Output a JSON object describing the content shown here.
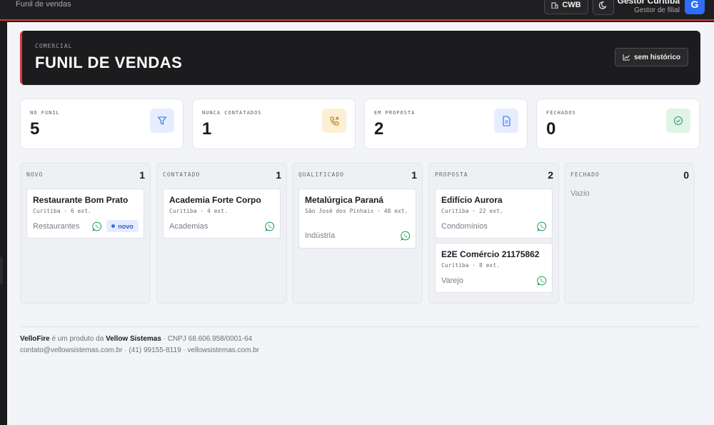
{
  "topbar": {
    "crumb": "Funil de vendas",
    "branch": "CWB",
    "user_name": "Gestor Curitiba",
    "user_role": "Gestor de filial",
    "avatar_letter": "G"
  },
  "hero": {
    "eyebrow": "COMERCIAL",
    "title": "FUNIL DE VENDAS",
    "history_button": "sem histórico"
  },
  "stats": [
    {
      "label": "NO FUNIL",
      "value": "5",
      "icon": "filter-icon",
      "color": "#2f6df6"
    },
    {
      "label": "NUNCA CONTATADOS",
      "value": "1",
      "icon": "phone-icon",
      "color": "#b7791f"
    },
    {
      "label": "EM PROPOSTA",
      "value": "2",
      "icon": "document-icon",
      "color": "#2f6df6"
    },
    {
      "label": "FECHADOS",
      "value": "0",
      "icon": "check-circle-icon",
      "color": "#2f9e57"
    }
  ],
  "columns": [
    {
      "title": "NOVO",
      "count": "1",
      "cards": [
        {
          "name": "Restaurante Bom Prato",
          "meta": "Curitiba · 6 ext.",
          "segment": "Restaurantes",
          "badge": "novo"
        }
      ]
    },
    {
      "title": "CONTATADO",
      "count": "1",
      "cards": [
        {
          "name": "Academia Forte Corpo",
          "meta": "Curitiba · 4 ext.",
          "segment": "Academias"
        }
      ]
    },
    {
      "title": "QUALIFICADO",
      "count": "1",
      "cards": [
        {
          "name": "Metalúrgica Paraná",
          "meta": "São José dos Pinhais · 48 ext.",
          "segment": "Indústria"
        }
      ]
    },
    {
      "title": "PROPOSTA",
      "count": "2",
      "cards": [
        {
          "name": "Edifício Aurora",
          "meta": "Curitiba · 22 ext.",
          "segment": "Condomínios"
        },
        {
          "name": "E2E Comércio 21175862",
          "meta": "Curitiba · 8 ext.",
          "segment": "Varejo"
        }
      ]
    },
    {
      "title": "FECHADO",
      "count": "0",
      "empty": "Vazio",
      "cards": []
    }
  ],
  "footer": {
    "brand": "VelloFire",
    "mid": " é um produto da ",
    "company": "Vellow Sistemas",
    "cnpj": " · CNPJ 68.606.958/0001-64",
    "contact": "contato@vellowsistemas.com.br · (41) 99155-8119 · vellowsistemas.com.br"
  },
  "colors": {
    "accent": "#d33a3a",
    "whatsapp": "#25a55f",
    "primary": "#2f6df6"
  }
}
